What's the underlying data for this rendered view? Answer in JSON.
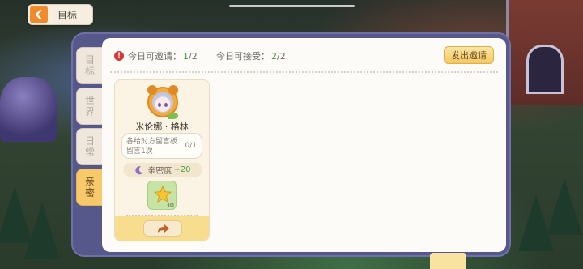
{
  "header": {
    "back_label": "目标"
  },
  "tabs": [
    {
      "label_1": "目",
      "label_2": "标",
      "active": false
    },
    {
      "label_1": "世",
      "label_2": "界",
      "active": false
    },
    {
      "label_1": "日",
      "label_2": "常",
      "active": false
    },
    {
      "label_1": "亲",
      "label_2": "密",
      "active": true
    }
  ],
  "stats": {
    "invite_label": "今日可邀请：",
    "invite_current": "1",
    "invite_max": "/2",
    "accept_label": "今日可接受：",
    "accept_current": "2",
    "accept_max": "/2"
  },
  "invite_button": "发出邀请",
  "friend_card": {
    "name": "米伦娜 · 格林",
    "task": "各给对方留言板留言1次",
    "progress": "0/1",
    "intimacy_label": "亲密度",
    "intimacy_value": "+20",
    "reward_count": "30"
  },
  "colors": {
    "accent_orange": "#f08a2a",
    "active_tab": "#f7c96a",
    "panel_frame": "#56578a",
    "positive_green": "#3f9b3a",
    "alert_red": "#d83838"
  },
  "icons": [
    "back-arrow-icon",
    "alert-icon",
    "moon-icon",
    "star-reward-icon",
    "send-arrow-icon"
  ]
}
